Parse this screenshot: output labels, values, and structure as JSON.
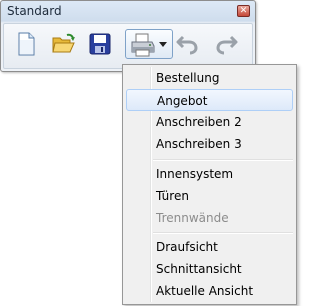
{
  "window": {
    "title": "Standard",
    "close_glyph": "✕"
  },
  "toolbar": {
    "buttons": [
      {
        "name": "new-document",
        "icon": "new-document-icon"
      },
      {
        "name": "open-folder",
        "icon": "open-folder-icon"
      },
      {
        "name": "save",
        "icon": "floppy-disk-icon"
      },
      {
        "name": "print",
        "icon": "printer-icon",
        "has_dropdown": true
      },
      {
        "name": "undo",
        "icon": "undo-icon",
        "enabled": false
      },
      {
        "name": "redo",
        "icon": "redo-icon",
        "enabled": false
      }
    ]
  },
  "menu": {
    "groups": [
      [
        "Bestellung",
        "Angebot",
        "Anschreiben 2",
        "Anschreiben 3"
      ],
      [
        "Innensystem",
        "Türen",
        "Trennwände"
      ],
      [
        "Draufsicht",
        "Schnittansicht",
        "Aktuelle Ansicht"
      ]
    ],
    "highlighted": "Angebot",
    "disabled": [
      "Trennwände"
    ]
  },
  "colors": {
    "highlight_border": "#aecff7",
    "disabled_text": "#8c8c8c",
    "menu_background": "#f0f0f0"
  }
}
